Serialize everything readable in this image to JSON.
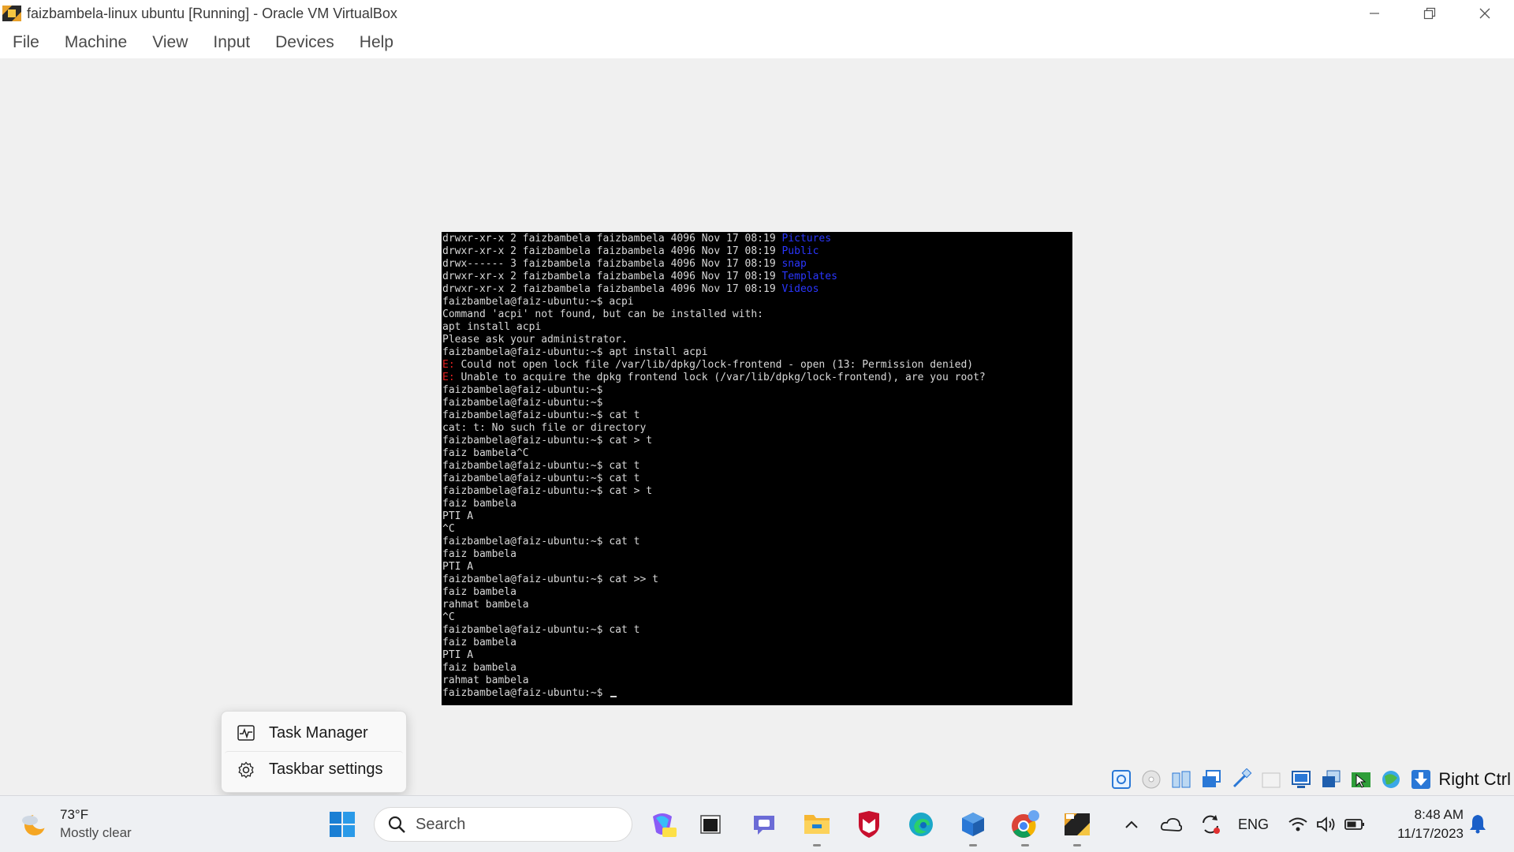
{
  "window": {
    "title": "faizbambela-linux ubuntu [Running] - Oracle VM VirtualBox"
  },
  "menu": [
    "File",
    "Machine",
    "View",
    "Input",
    "Devices",
    "Help"
  ],
  "terminal": {
    "lines": [
      {
        "segs": [
          {
            "t": "drwxr-xr-x 2 faizbambela faizbambela 4096 Nov 17 08:19 "
          },
          {
            "t": "Pictures",
            "c": "blue"
          }
        ]
      },
      {
        "segs": [
          {
            "t": "drwxr-xr-x 2 faizbambela faizbambela 4096 Nov 17 08:19 "
          },
          {
            "t": "Public",
            "c": "blue"
          }
        ]
      },
      {
        "segs": [
          {
            "t": "drwx------ 3 faizbambela faizbambela 4096 Nov 17 08:19 "
          },
          {
            "t": "snap",
            "c": "blue"
          }
        ]
      },
      {
        "segs": [
          {
            "t": "drwxr-xr-x 2 faizbambela faizbambela 4096 Nov 17 08:19 "
          },
          {
            "t": "Templates",
            "c": "blue"
          }
        ]
      },
      {
        "segs": [
          {
            "t": "drwxr-xr-x 2 faizbambela faizbambela 4096 Nov 17 08:19 "
          },
          {
            "t": "Videos",
            "c": "blue"
          }
        ]
      },
      {
        "segs": [
          {
            "t": "faizbambela@faiz-ubuntu:~$ acpi"
          }
        ]
      },
      {
        "segs": [
          {
            "t": "Command 'acpi' not found, but can be installed with:"
          }
        ]
      },
      {
        "segs": [
          {
            "t": "apt install acpi"
          }
        ]
      },
      {
        "segs": [
          {
            "t": "Please ask your administrator."
          }
        ]
      },
      {
        "segs": [
          {
            "t": "faizbambela@faiz-ubuntu:~$ apt install acpi"
          }
        ]
      },
      {
        "segs": [
          {
            "t": "E:",
            "c": "red"
          },
          {
            "t": " Could not open lock file /var/lib/dpkg/lock-frontend - open (13: Permission denied)"
          }
        ]
      },
      {
        "segs": [
          {
            "t": "E:",
            "c": "red"
          },
          {
            "t": " Unable to acquire the dpkg frontend lock (/var/lib/dpkg/lock-frontend), are you root?"
          }
        ]
      },
      {
        "segs": [
          {
            "t": "faizbambela@faiz-ubuntu:~$"
          }
        ]
      },
      {
        "segs": [
          {
            "t": "faizbambela@faiz-ubuntu:~$"
          }
        ]
      },
      {
        "segs": [
          {
            "t": "faizbambela@faiz-ubuntu:~$ cat t"
          }
        ]
      },
      {
        "segs": [
          {
            "t": "cat: t: No such file or directory"
          }
        ]
      },
      {
        "segs": [
          {
            "t": "faizbambela@faiz-ubuntu:~$ cat > t"
          }
        ]
      },
      {
        "segs": [
          {
            "t": "faiz bambela^C"
          }
        ]
      },
      {
        "segs": [
          {
            "t": "faizbambela@faiz-ubuntu:~$ cat t"
          }
        ]
      },
      {
        "segs": [
          {
            "t": "faizbambela@faiz-ubuntu:~$ cat t"
          }
        ]
      },
      {
        "segs": [
          {
            "t": "faizbambela@faiz-ubuntu:~$ cat > t"
          }
        ]
      },
      {
        "segs": [
          {
            "t": "faiz bambela"
          }
        ]
      },
      {
        "segs": [
          {
            "t": "PTI A"
          }
        ]
      },
      {
        "segs": [
          {
            "t": "^C"
          }
        ]
      },
      {
        "segs": [
          {
            "t": "faizbambela@faiz-ubuntu:~$ cat t"
          }
        ]
      },
      {
        "segs": [
          {
            "t": "faiz bambela"
          }
        ]
      },
      {
        "segs": [
          {
            "t": "PTI A"
          }
        ]
      },
      {
        "segs": [
          {
            "t": "faizbambela@faiz-ubuntu:~$ cat >> t"
          }
        ]
      },
      {
        "segs": [
          {
            "t": "faiz bambela"
          }
        ]
      },
      {
        "segs": [
          {
            "t": "rahmat bambela"
          }
        ]
      },
      {
        "segs": [
          {
            "t": "^C"
          }
        ]
      },
      {
        "segs": [
          {
            "t": "faizbambela@faiz-ubuntu:~$ cat t"
          }
        ]
      },
      {
        "segs": [
          {
            "t": "faiz bambela"
          }
        ]
      },
      {
        "segs": [
          {
            "t": "PTI A"
          }
        ]
      },
      {
        "segs": [
          {
            "t": "faiz bambela"
          }
        ]
      },
      {
        "segs": [
          {
            "t": "rahmat bambela"
          }
        ]
      },
      {
        "segs": [
          {
            "t": "faizbambela@faiz-ubuntu:~$ "
          }
        ],
        "cursor": true
      }
    ]
  },
  "context_menu": {
    "task_manager": "Task Manager",
    "taskbar_settings": "Taskbar settings"
  },
  "statusbar": {
    "host_key": "Right Ctrl",
    "icons": [
      "hard-disk-icon",
      "optical-drive-icon",
      "audio-icon",
      "network-icon",
      "usb-icon",
      "shared-folders-icon",
      "display-icon",
      "recording-icon",
      "mouse-integration-icon",
      "cpu-icon",
      "download-icon"
    ]
  },
  "taskbar": {
    "weather_temp": "73°F",
    "weather_cond": "Mostly clear",
    "search_label": "Search",
    "lang": "ENG",
    "time": "8:48 AM",
    "date": "11/17/2023"
  },
  "colors": {
    "terminal_bg": "#000000",
    "terminal_fg": "#d8d8d8",
    "dir_blue": "#2a36ff",
    "error_red": "#e02020",
    "taskbar_bg": "#eef0f3"
  }
}
